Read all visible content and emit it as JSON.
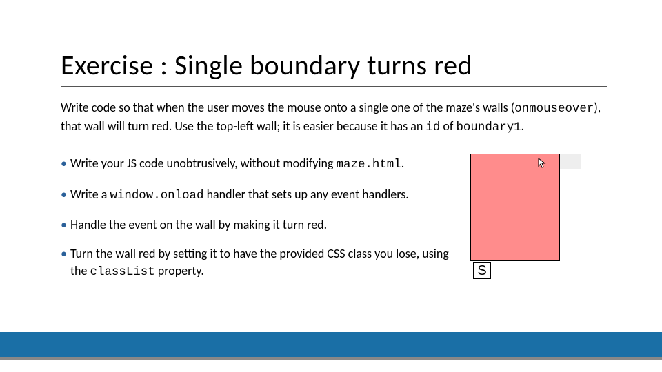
{
  "title": "Exercise : Single boundary turns red",
  "intro": {
    "part1": "Write code so that when the user moves the mouse onto a single one of the maze's walls (",
    "code1": "onmouseover",
    "part2": "), that wall will turn red. Use the top-left wall; it is easier because it has an ",
    "code2": "id",
    "part3": " of ",
    "code3": "boundary1",
    "part4": "."
  },
  "bullets": [
    {
      "pre": "Write your JS code unobtrusively, without modifying ",
      "code": "maze.html",
      "post": "."
    },
    {
      "pre": "Write a ",
      "code": "window.onload",
      "post": " handler that sets up any event handlers."
    },
    {
      "pre": "Handle the event on the wall by making it turn red.",
      "code": "",
      "post": ""
    },
    {
      "pre": "Turn the wall red by setting it to have the provided CSS class you lose, using the ",
      "code": "classList",
      "post": " property."
    }
  ],
  "figure": {
    "start_label": "S"
  }
}
